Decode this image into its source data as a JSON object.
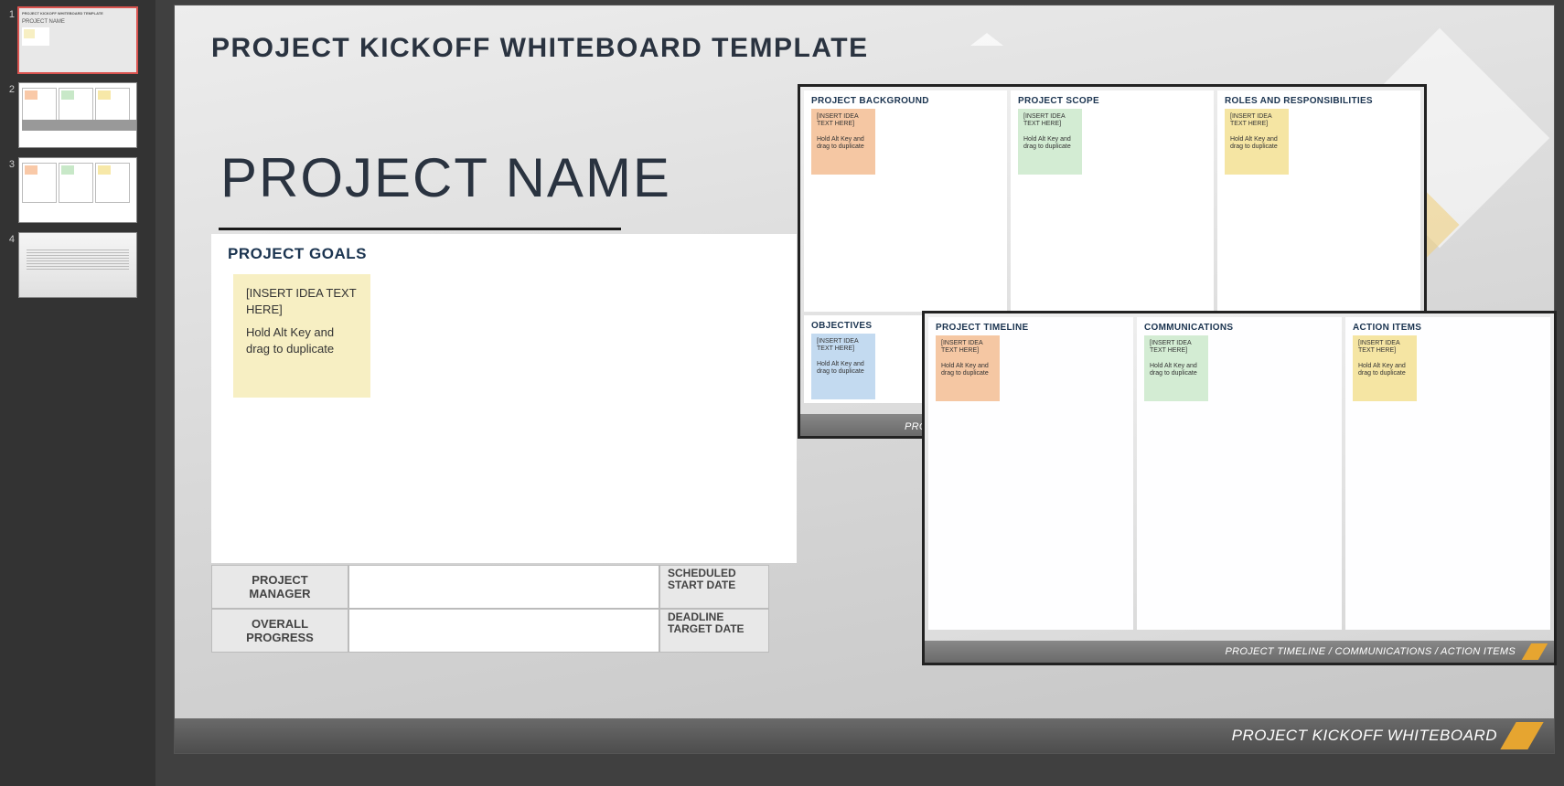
{
  "thumbs": [
    1,
    2,
    3,
    4
  ],
  "main": {
    "title": "PROJECT KICKOFF WHITEBOARD TEMPLATE",
    "project_name": "PROJECT NAME",
    "goals_head": "PROJECT GOALS",
    "sticky_title": "[INSERT IDEA TEXT HERE]",
    "sticky_hint": "Hold Alt Key and drag to duplicate",
    "table": {
      "pm": "PROJECT MANAGER",
      "progress": "OVERALL PROGRESS",
      "start": "SCHEDULED START DATE",
      "deadline": "DEADLINE TARGET DATE"
    },
    "footer": "PROJECT KICKOFF WHITEBOARD"
  },
  "mid": {
    "panels_top": [
      {
        "head": "PROJECT BACKGROUND",
        "color": "orange"
      },
      {
        "head": "PROJECT SCOPE",
        "color": "green"
      },
      {
        "head": "ROLES AND RESPONSIBILITIES",
        "color": "lyellow"
      }
    ],
    "panels_bottom": [
      {
        "head": "OBJECTIVES",
        "color": "blue"
      }
    ],
    "sticky_title": "[INSERT IDEA TEXT HERE]",
    "sticky_hint": "Hold Alt Key and drag to duplicate",
    "footer_visible": "PRO"
  },
  "right": {
    "panels": [
      {
        "head": "PROJECT TIMELINE",
        "color": "orange"
      },
      {
        "head": "COMMUNICATIONS",
        "color": "green"
      },
      {
        "head": "ACTION ITEMS",
        "color": "lyellow"
      }
    ],
    "sticky_title": "[INSERT IDEA TEXT HERE]",
    "sticky_hint": "Hold Alt Key and drag to duplicate",
    "footer": "PROJECT TIMELINE / COMMUNICATIONS / ACTION ITEMS"
  }
}
